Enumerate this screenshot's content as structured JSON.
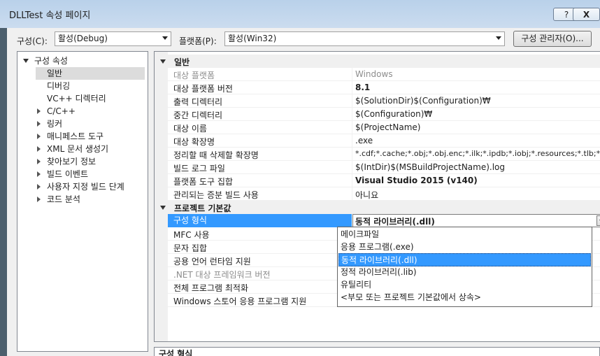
{
  "window": {
    "title": "DLLTest 속성 페이지",
    "help_label": "?",
    "close_label": "X"
  },
  "toolbar": {
    "config_label": "구성(C):",
    "config_value": "활성(Debug)",
    "platform_label": "플랫폼(P):",
    "platform_value": "활성(Win32)",
    "manager_label": "구성 관리자(O)..."
  },
  "tree": {
    "root": "구성 속성",
    "items": [
      {
        "label": "일반",
        "selected": true
      },
      {
        "label": "디버깅"
      },
      {
        "label": "VC++ 디렉터리"
      },
      {
        "label": "C/C++"
      },
      {
        "label": "링커"
      },
      {
        "label": "매니페스트 도구"
      },
      {
        "label": "XML 문서 생성기"
      },
      {
        "label": "찾아보기 정보"
      },
      {
        "label": "빌드 이벤트"
      },
      {
        "label": "사용자 지정 빌드 단계"
      },
      {
        "label": "코드 분석"
      }
    ]
  },
  "grid": {
    "categories": [
      {
        "title": "일반",
        "rows": [
          {
            "name": "대상 플랫폼",
            "value": "Windows",
            "disabled": true
          },
          {
            "name": "대상 플랫폼 버전",
            "value": "8.1",
            "bold": true
          },
          {
            "name": "출력 디렉터리",
            "value": "$(SolutionDir)$(Configuration)₩"
          },
          {
            "name": "중간 디렉터리",
            "value": "$(Configuration)₩"
          },
          {
            "name": "대상 이름",
            "value": "$(ProjectName)"
          },
          {
            "name": "대상 확장명",
            "value": ".exe"
          },
          {
            "name": "정리할 때 삭제할 확장명",
            "value": "*.cdf;*.cache;*.obj;*.obj.enc;*.ilk;*.ipdb;*.iobj;*.resources;*.tlb;*.tli;*.tl"
          },
          {
            "name": "빌드 로그 파일",
            "value": "$(IntDir)$(MSBuildProjectName).log"
          },
          {
            "name": "플랫폼 도구 집합",
            "value": "Visual Studio 2015 (v140)",
            "bold": true
          },
          {
            "name": "관리되는 증분 빌드 사용",
            "value": "아니요"
          }
        ]
      },
      {
        "title": "프로젝트 기본값",
        "rows": [
          {
            "name": "구성 형식",
            "value": "동적 라이브러리(.dll)",
            "selected": true
          },
          {
            "name": "MFC 사용",
            "value": ""
          },
          {
            "name": "문자 집합",
            "value": ""
          },
          {
            "name": "공용 언어 런타임 지원",
            "value": ""
          },
          {
            "name": ".NET 대상 프레임워크 버전",
            "value": "",
            "disabled": true
          },
          {
            "name": "전체 프로그램 최적화",
            "value": ""
          },
          {
            "name": "Windows 스토어 응용 프로그램 지원",
            "value": ""
          }
        ]
      }
    ]
  },
  "dropdown": {
    "options": [
      "메이크파일",
      "응용 프로그램(.exe)",
      "동적 라이브러리(.dll)",
      "정적 라이브러리(.lib)",
      "유틸리티",
      "<부모 또는 프로젝트 기본값에서 상속>"
    ],
    "highlighted_index": 2
  },
  "description": {
    "title": "구성 형식"
  }
}
